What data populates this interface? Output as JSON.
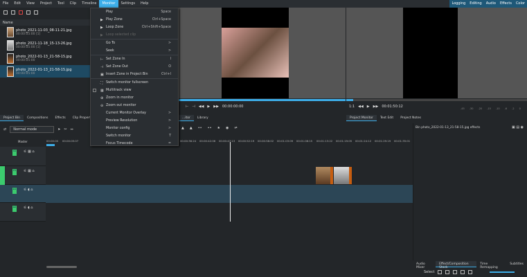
{
  "menubar": {
    "items": [
      "File",
      "Edit",
      "View",
      "Project",
      "Tool",
      "Clip",
      "Timeline",
      "Monitor",
      "Settings",
      "Help"
    ],
    "open": "Monitor"
  },
  "layouts": [
    "Logging",
    "Editing",
    "Audio",
    "Effects",
    "Color"
  ],
  "bin": {
    "header": "Name",
    "items": [
      {
        "name": "photo_2021-11-03_08-11-21.jpg",
        "dur": "00:00:05:00 [1]"
      },
      {
        "name": "photo_2021-11-18_15-13-26.jpg",
        "dur": "00:00:05:00 [1]"
      },
      {
        "name": "photo_2022-01-13_21-58-15.jpg",
        "dur": "00:00:05:00"
      },
      {
        "name": "photo_2022-01-13_21-58-15.jpg",
        "dur": "00:00:05:00"
      }
    ]
  },
  "left_tabs": [
    "Project Bin",
    "Compositions",
    "Effects",
    "Clip Properties"
  ],
  "monitor_menu": [
    {
      "label": "Play",
      "shortcut": "Space",
      "icon": ""
    },
    {
      "label": "Play Zone",
      "shortcut": "Ctrl+Space",
      "icon": "▶"
    },
    {
      "label": "Loop Zone",
      "shortcut": "Ctrl+Shift+Space",
      "icon": "▶"
    },
    {
      "label": "Loop selected clip",
      "shortcut": "",
      "icon": "▶",
      "disabled": true
    },
    {
      "label": "Go To",
      "shortcut": ">",
      "icon": ""
    },
    {
      "label": "Seek",
      "shortcut": ">",
      "icon": ""
    },
    {
      "label": "Set Zone In",
      "shortcut": "I",
      "icon": "⊢"
    },
    {
      "label": "Set Zone Out",
      "shortcut": "O",
      "icon": "⊣"
    },
    {
      "label": "Insert Zone in Project Bin",
      "shortcut": "Ctrl+I",
      "icon": "▣"
    },
    {
      "label": "Switch monitor fullscreen",
      "shortcut": "",
      "icon": "⛶"
    },
    {
      "label": "Multitrack view",
      "shortcut": "",
      "icon": "▦",
      "checkbox": true
    },
    {
      "label": "Zoom in monitor",
      "shortcut": "",
      "icon": "⊕"
    },
    {
      "label": "Zoom out monitor",
      "shortcut": "",
      "icon": "⊖"
    },
    {
      "label": "Current Monitor Overlay",
      "shortcut": ">",
      "icon": ""
    },
    {
      "label": "Preview Resolution",
      "shortcut": ">",
      "icon": ""
    },
    {
      "label": "Monitor config",
      "shortcut": ">",
      "icon": ""
    },
    {
      "label": "Switch monitor",
      "shortcut": "T",
      "icon": ""
    },
    {
      "label": "Focus Timecode",
      "shortcut": "=",
      "icon": ""
    }
  ],
  "clip_monitor": {
    "timecode": "00:00:00:00",
    "tabs": [
      "...itor",
      "Library"
    ]
  },
  "project_monitor": {
    "timecode": "00:01:50:12",
    "zoom": "1:1",
    "tabs": [
      "Project Monitor",
      "Text Edit",
      "Project Notes"
    ],
    "meter": [
      "-45",
      "-30",
      "-20",
      "-15",
      "-10",
      "-6",
      "-2",
      "0"
    ]
  },
  "timeline": {
    "mode": "Normal mode",
    "master": "Master",
    "ruler": [
      "00:00:00",
      "00:00:05:07",
      "00:00:36:24",
      "00:00:42:06",
      "00:00:47:13",
      "00:00:52:19",
      "00:00:58:02",
      "00:01:03:09",
      "00:01:08:15",
      "00:01:13:22",
      "00:01:19:05",
      "00:01:24:12",
      "00:01:29:19",
      "00:01:35:01"
    ],
    "tracks": [
      "V2",
      "V1",
      "A1",
      "A2"
    ]
  },
  "effects": {
    "title": "Bin photo_2022-01-13_21-58-15.jpg effects",
    "tabs": [
      "Audio Mixer",
      "Effect/Composition Stack",
      "Time Remapping",
      "Subtitles"
    ],
    "select": "Select"
  },
  "colors": {
    "accent": "#3daee9",
    "track_tag": "#3ccb6e",
    "selected_track": "#2c4656"
  }
}
